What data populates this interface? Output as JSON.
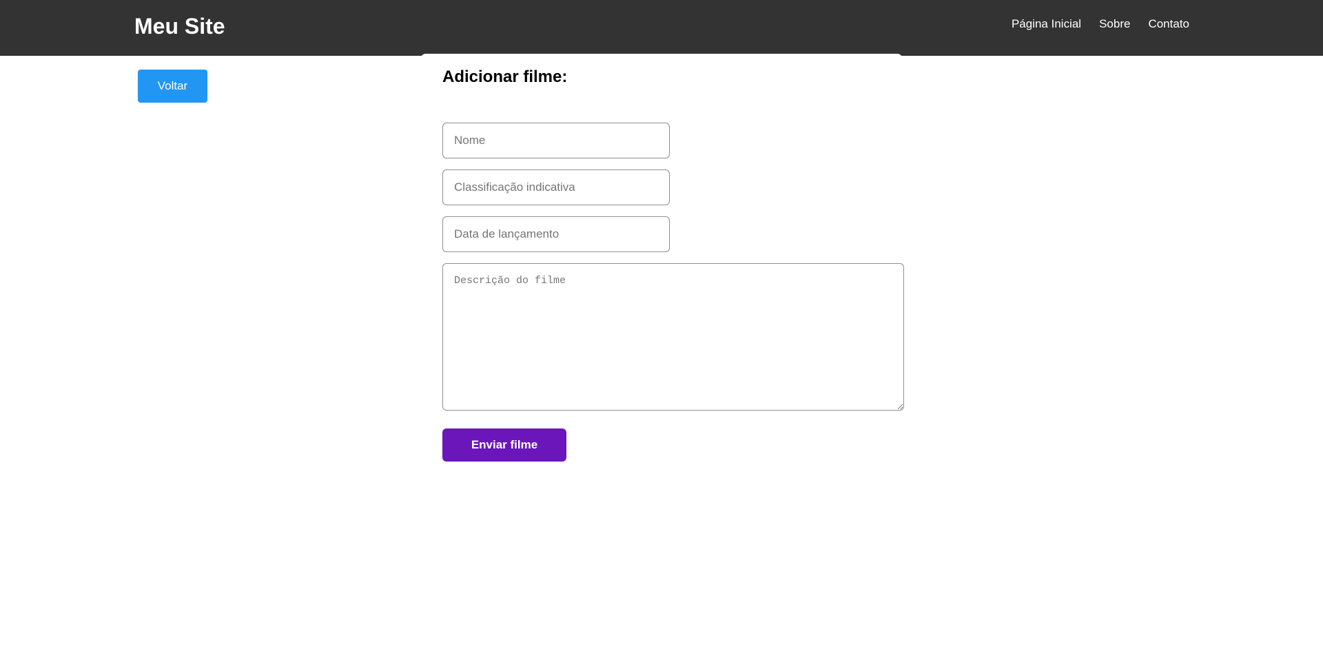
{
  "header": {
    "brand": "Meu Site",
    "nav": [
      {
        "label": "Página Inicial"
      },
      {
        "label": "Sobre"
      },
      {
        "label": "Contato"
      }
    ]
  },
  "back_button": {
    "label": "Voltar"
  },
  "form": {
    "title": "Adicionar filme:",
    "fields": {
      "nome": {
        "value": "",
        "placeholder": "Nome"
      },
      "classificacao": {
        "value": "",
        "placeholder": "Classificação indicativa"
      },
      "data": {
        "value": "",
        "placeholder": "Data de lançamento"
      },
      "descricao": {
        "value": "",
        "placeholder": "Descrição do filme"
      }
    },
    "submit_label": "Enviar filme"
  },
  "colors": {
    "header_bg": "#333333",
    "back_button": "#2196f3",
    "submit_button": "#6a16bb"
  }
}
